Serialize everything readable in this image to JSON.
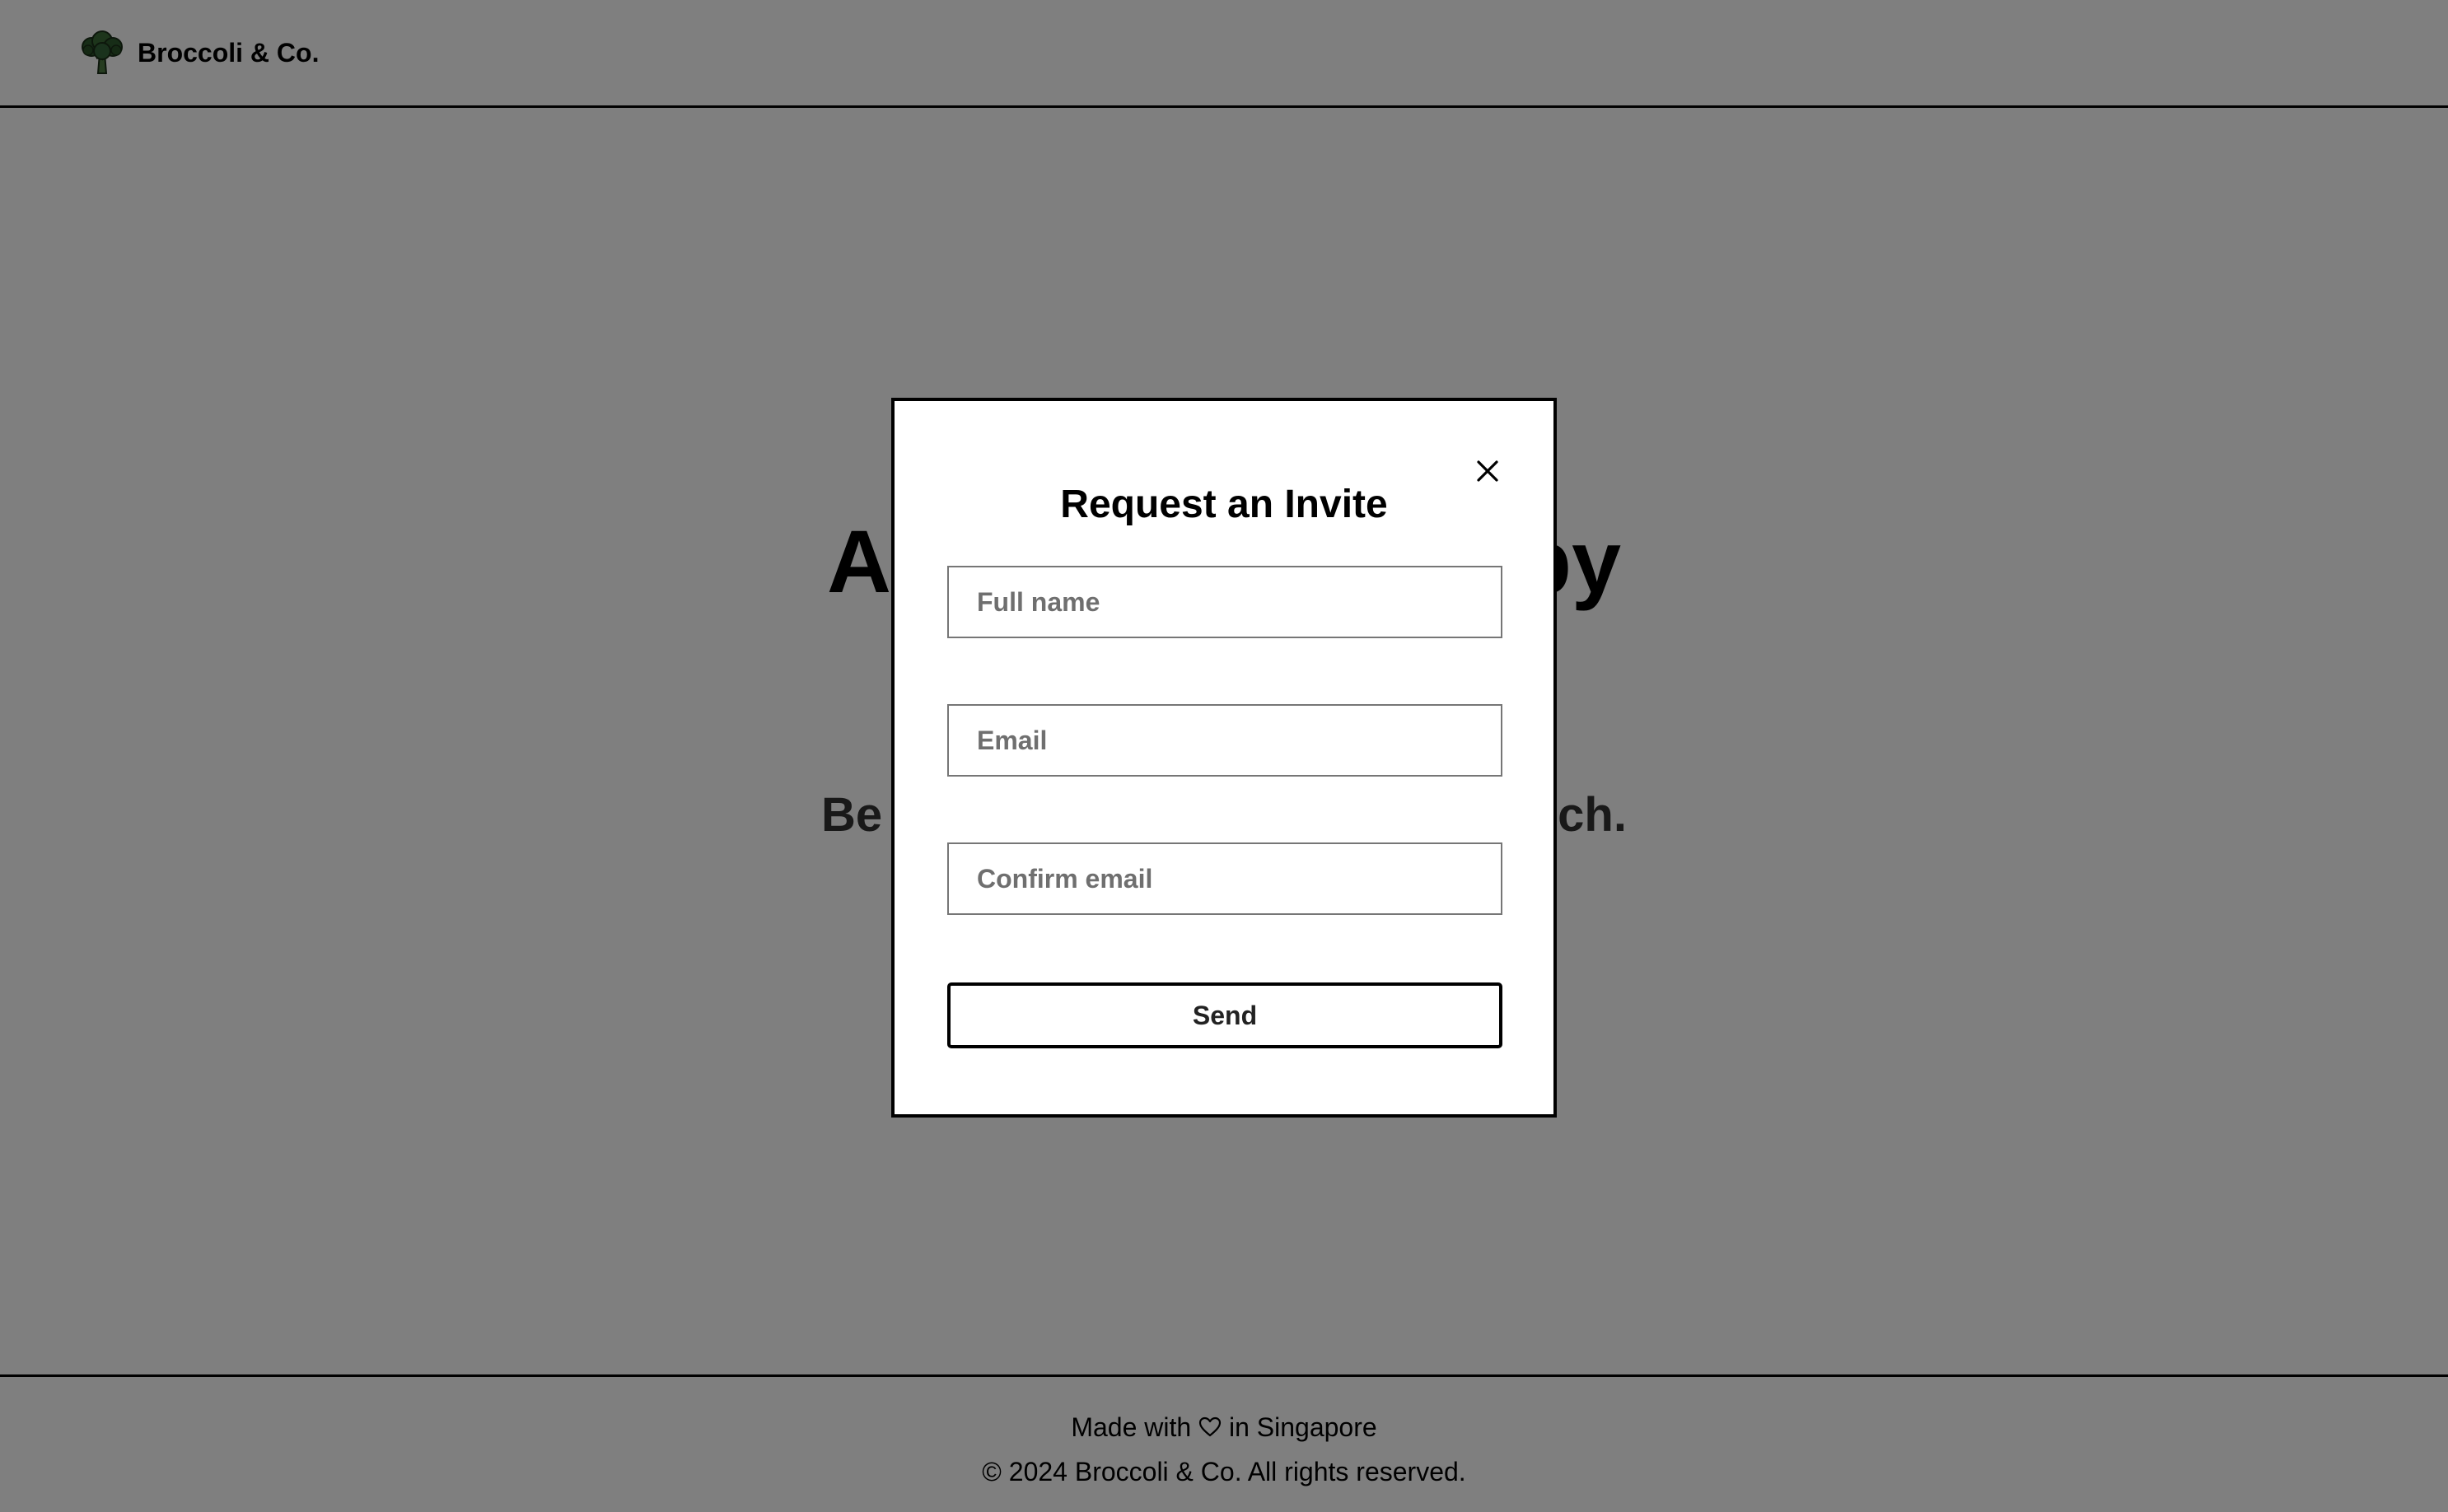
{
  "header": {
    "brand": "Broccoli & Co.",
    "logo_icon": "broccoli-icon"
  },
  "hero": {
    "title_left": "A",
    "title_right": "py",
    "subtitle_left": "Be",
    "subtitle_right": "ch."
  },
  "modal": {
    "title": "Request an Invite",
    "close_icon": "close-icon",
    "fields": {
      "full_name_placeholder": "Full name",
      "email_placeholder": "Email",
      "confirm_email_placeholder": "Confirm email"
    },
    "send_label": "Send"
  },
  "footer": {
    "made_with_prefix": "Made with",
    "made_with_suffix": "in Singapore",
    "heart_icon": "heart-icon",
    "copyright": "© 2024 Broccoli & Co. All rights reserved."
  },
  "colors": {
    "overlay": "#808080",
    "modal_background": "#ffffff",
    "border": "#000000",
    "logo_green": "#2f5a2e"
  }
}
